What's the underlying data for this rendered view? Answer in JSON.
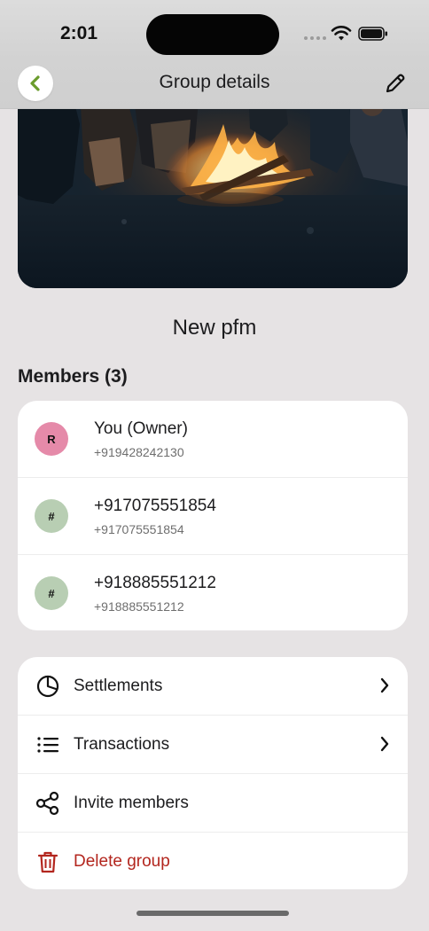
{
  "status_bar": {
    "time": "2:01"
  },
  "header": {
    "title": "Group details"
  },
  "group": {
    "name": "New pfm"
  },
  "members_section": {
    "title": "Members (3)",
    "members": [
      {
        "initial": "R",
        "name": "You (Owner)",
        "phone": "+919428242130",
        "color": "#e58aa9"
      },
      {
        "initial": "#",
        "name": "+917075551854",
        "phone": "+917075551854",
        "color": "#b8ceb3"
      },
      {
        "initial": "#",
        "name": "+918885551212",
        "phone": "+918885551212",
        "color": "#b8ceb3"
      }
    ]
  },
  "actions": [
    {
      "label": "Settlements",
      "icon": "pie-chart-icon",
      "chevron": true
    },
    {
      "label": "Transactions",
      "icon": "list-icon",
      "chevron": true
    },
    {
      "label": "Invite members",
      "icon": "share-icon",
      "chevron": false
    },
    {
      "label": "Delete group",
      "icon": "trash-icon",
      "chevron": false,
      "color": "#b3261e"
    }
  ],
  "colors": {
    "back_chevron": "#6a9c2c",
    "danger": "#b3261e"
  }
}
